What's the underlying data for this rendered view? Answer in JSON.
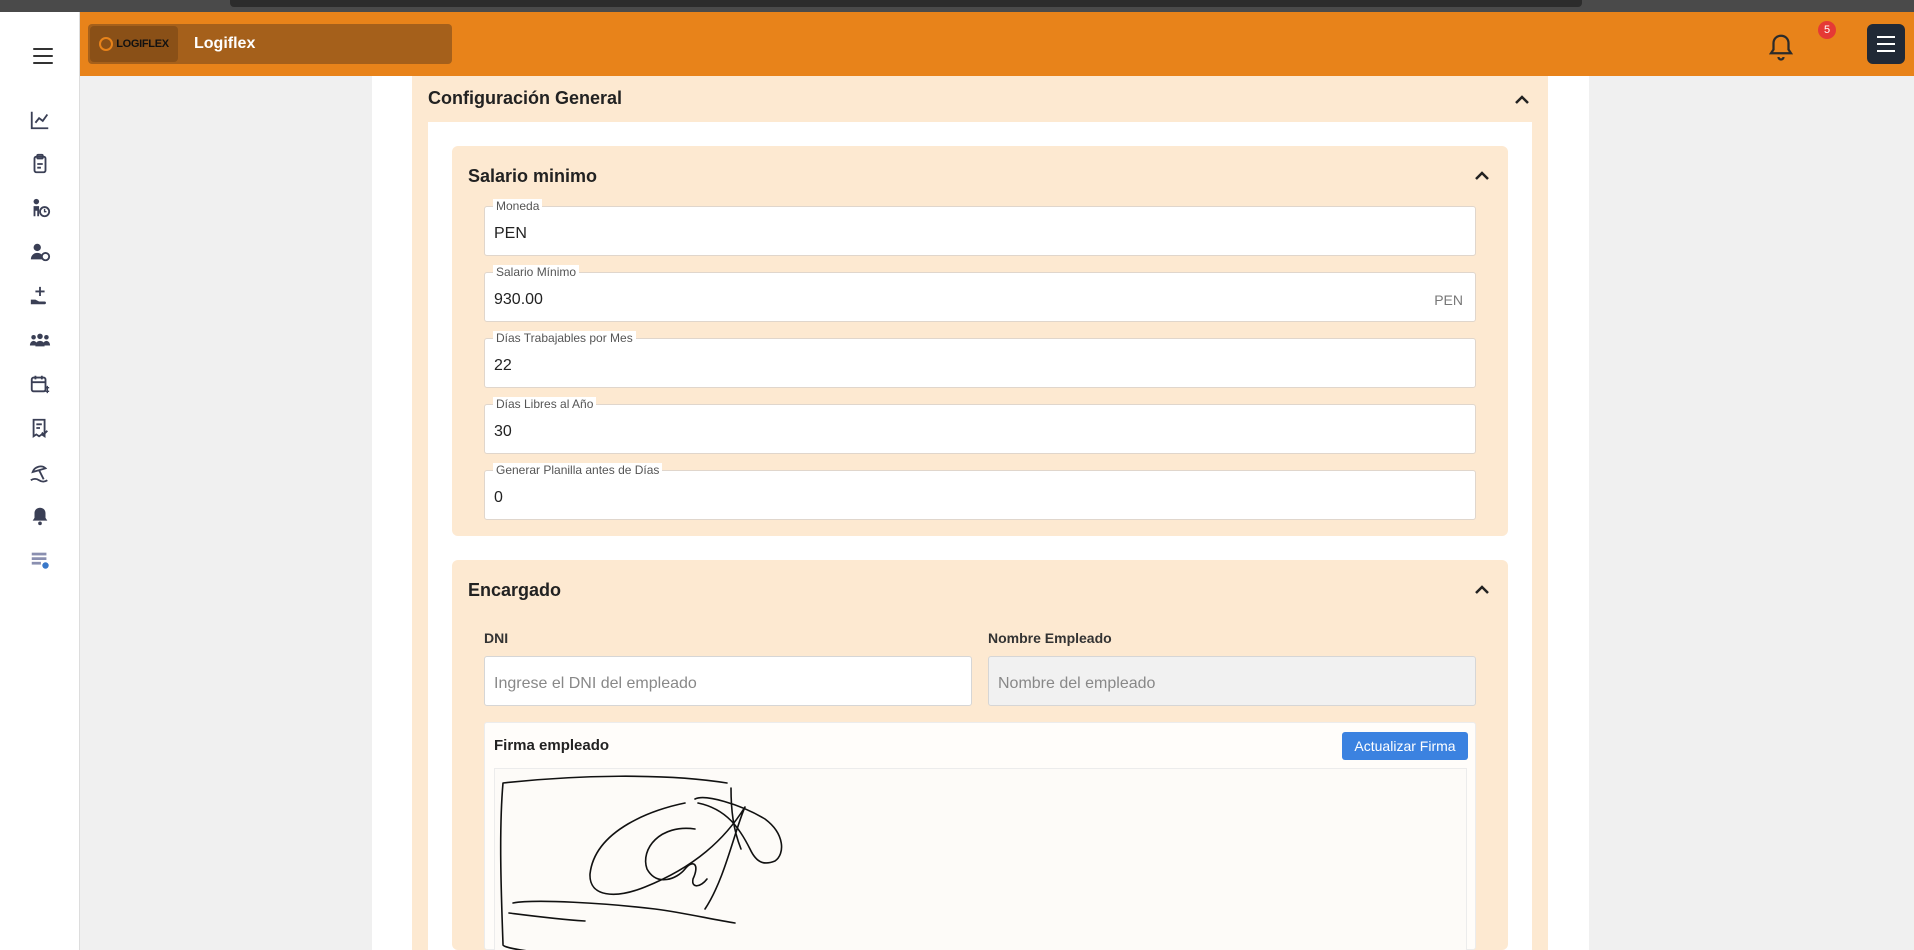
{
  "header": {
    "brand_logo_text": "LOGIFLEX",
    "brand_name": "Logiflex",
    "notification_count": "5"
  },
  "sidebar": {
    "icons": [
      "chart-line-icon",
      "clipboard-icon",
      "person-clock-icon",
      "user-clock-icon",
      "hand-plus-icon",
      "people-group-icon",
      "calendar-dollar-icon",
      "receipt-check-icon",
      "umbrella-beach-icon",
      "bell-icon",
      "table-settings-icon"
    ]
  },
  "config": {
    "title": "Configuración General",
    "salario": {
      "title": "Salario minimo",
      "fields": [
        {
          "label": "Moneda",
          "value": "PEN",
          "suffix": ""
        },
        {
          "label": "Salario Mínimo",
          "value": "930.00",
          "suffix": "PEN"
        },
        {
          "label": "Días Trabajables por Mes",
          "value": "22",
          "suffix": ""
        },
        {
          "label": "Días Libres al Año",
          "value": "30",
          "suffix": ""
        },
        {
          "label": "Generar Planilla antes de Días",
          "value": "0",
          "suffix": ""
        }
      ]
    },
    "encargado": {
      "title": "Encargado",
      "dni_label": "DNI",
      "dni_placeholder": "Ingrese el DNI del empleado",
      "nombre_label": "Nombre Empleado",
      "nombre_placeholder": "Nombre del empleado",
      "firma_title": "Firma empleado",
      "firma_button": "Actualizar Firma"
    }
  },
  "colors": {
    "header": "#e8831a",
    "section_bg": "#fde9d1",
    "button_blue": "#3b82e0",
    "badge_red": "#e53935"
  }
}
